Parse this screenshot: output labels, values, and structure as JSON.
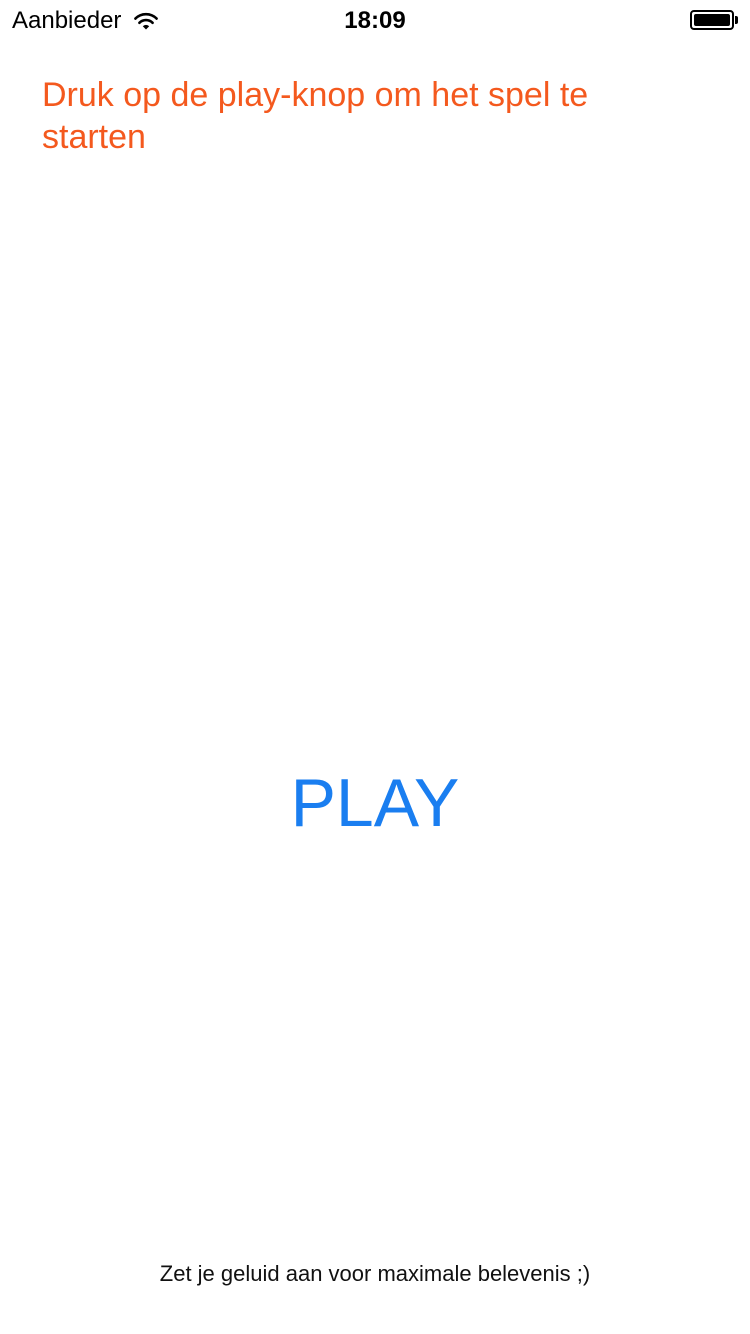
{
  "status_bar": {
    "carrier": "Aanbieder",
    "time": "18:09",
    "wifi_icon": "wifi-icon",
    "battery_icon": "battery-icon",
    "battery_level": 1.0
  },
  "main": {
    "instruction": "Druk op de play-knop om het spel te starten",
    "play_label": "PLAY",
    "sound_hint": "Zet je geluid aan voor maximale belevenis ;)"
  },
  "colors": {
    "instruction": "#f4591e",
    "play": "#1a7ef0",
    "background": "#ffffff"
  }
}
